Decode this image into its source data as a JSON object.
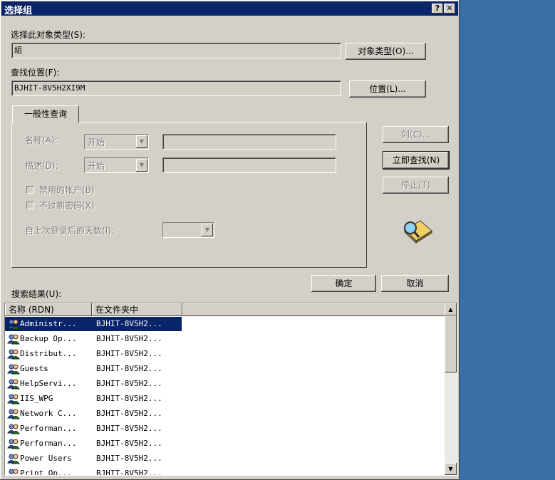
{
  "window": {
    "title": "选择组",
    "help_label": "?",
    "close_label": "✕"
  },
  "object_type": {
    "label": "选择此对象类型(S):",
    "value": "組",
    "button": "对象类型(O)..."
  },
  "location": {
    "label": "查找位置(F):",
    "value": "BJHIT-8V5H2XI9M",
    "button": "位置(L)..."
  },
  "tab": {
    "label": "一般性查询"
  },
  "query": {
    "name_label": "名称(A):",
    "name_mode": "开始",
    "name_value": "",
    "desc_label": "描述(D):",
    "desc_mode": "开始",
    "desc_value": "",
    "disabled_accounts": "禁用的帐户(B)",
    "non_expiring": "不过期密码(X)",
    "days_label": "自上次登录后的天数(I):",
    "days_value": ""
  },
  "side_buttons": {
    "columns": "列(C)...",
    "find_now": "立即查找(N)",
    "stop": "停止(T)"
  },
  "actions": {
    "ok": "确定",
    "cancel": "取消"
  },
  "results": {
    "label": "搜索结果(U):",
    "columns": [
      "名称 (RDN)",
      "在文件夹中"
    ],
    "rows": [
      {
        "name": "Administr...",
        "folder": "BJHIT-8V5H2..."
      },
      {
        "name": "Backup Op...",
        "folder": "BJHIT-8V5H2..."
      },
      {
        "name": "Distribut...",
        "folder": "BJHIT-8V5H2..."
      },
      {
        "name": "Guests",
        "folder": "BJHIT-8V5H2..."
      },
      {
        "name": "HelpServi...",
        "folder": "BJHIT-8V5H2..."
      },
      {
        "name": "IIS_WPG",
        "folder": "BJHIT-8V5H2..."
      },
      {
        "name": "Network C...",
        "folder": "BJHIT-8V5H2..."
      },
      {
        "name": "Performan...",
        "folder": "BJHIT-8V5H2..."
      },
      {
        "name": "Performan...",
        "folder": "BJHIT-8V5H2..."
      },
      {
        "name": "Power Users",
        "folder": "BJHIT-8V5H2..."
      },
      {
        "name": "Print Op...",
        "folder": "BJHIT-8V5H2..."
      }
    ]
  },
  "colors": {
    "titlebar": "#0a246a",
    "face": "#d4d0c8",
    "desktop": "#3a6ea5",
    "selection": "#0a246a"
  }
}
